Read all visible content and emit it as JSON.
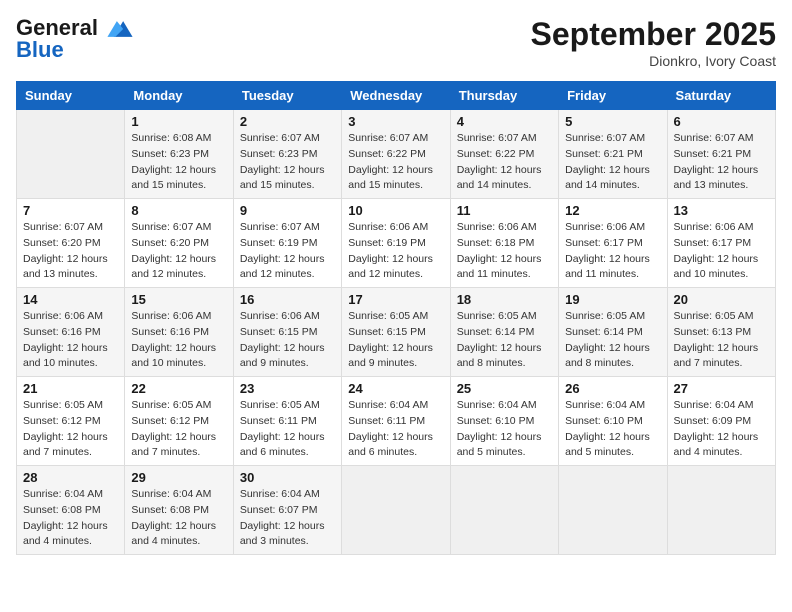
{
  "header": {
    "logo_line1": "General",
    "logo_line2": "Blue",
    "month": "September 2025",
    "location": "Dionkro, Ivory Coast"
  },
  "days_of_week": [
    "Sunday",
    "Monday",
    "Tuesday",
    "Wednesday",
    "Thursday",
    "Friday",
    "Saturday"
  ],
  "weeks": [
    [
      {
        "day": "",
        "info": ""
      },
      {
        "day": "1",
        "info": "Sunrise: 6:08 AM\nSunset: 6:23 PM\nDaylight: 12 hours\nand 15 minutes."
      },
      {
        "day": "2",
        "info": "Sunrise: 6:07 AM\nSunset: 6:23 PM\nDaylight: 12 hours\nand 15 minutes."
      },
      {
        "day": "3",
        "info": "Sunrise: 6:07 AM\nSunset: 6:22 PM\nDaylight: 12 hours\nand 15 minutes."
      },
      {
        "day": "4",
        "info": "Sunrise: 6:07 AM\nSunset: 6:22 PM\nDaylight: 12 hours\nand 14 minutes."
      },
      {
        "day": "5",
        "info": "Sunrise: 6:07 AM\nSunset: 6:21 PM\nDaylight: 12 hours\nand 14 minutes."
      },
      {
        "day": "6",
        "info": "Sunrise: 6:07 AM\nSunset: 6:21 PM\nDaylight: 12 hours\nand 13 minutes."
      }
    ],
    [
      {
        "day": "7",
        "info": "Sunrise: 6:07 AM\nSunset: 6:20 PM\nDaylight: 12 hours\nand 13 minutes."
      },
      {
        "day": "8",
        "info": "Sunrise: 6:07 AM\nSunset: 6:20 PM\nDaylight: 12 hours\nand 12 minutes."
      },
      {
        "day": "9",
        "info": "Sunrise: 6:07 AM\nSunset: 6:19 PM\nDaylight: 12 hours\nand 12 minutes."
      },
      {
        "day": "10",
        "info": "Sunrise: 6:06 AM\nSunset: 6:19 PM\nDaylight: 12 hours\nand 12 minutes."
      },
      {
        "day": "11",
        "info": "Sunrise: 6:06 AM\nSunset: 6:18 PM\nDaylight: 12 hours\nand 11 minutes."
      },
      {
        "day": "12",
        "info": "Sunrise: 6:06 AM\nSunset: 6:17 PM\nDaylight: 12 hours\nand 11 minutes."
      },
      {
        "day": "13",
        "info": "Sunrise: 6:06 AM\nSunset: 6:17 PM\nDaylight: 12 hours\nand 10 minutes."
      }
    ],
    [
      {
        "day": "14",
        "info": "Sunrise: 6:06 AM\nSunset: 6:16 PM\nDaylight: 12 hours\nand 10 minutes."
      },
      {
        "day": "15",
        "info": "Sunrise: 6:06 AM\nSunset: 6:16 PM\nDaylight: 12 hours\nand 10 minutes."
      },
      {
        "day": "16",
        "info": "Sunrise: 6:06 AM\nSunset: 6:15 PM\nDaylight: 12 hours\nand 9 minutes."
      },
      {
        "day": "17",
        "info": "Sunrise: 6:05 AM\nSunset: 6:15 PM\nDaylight: 12 hours\nand 9 minutes."
      },
      {
        "day": "18",
        "info": "Sunrise: 6:05 AM\nSunset: 6:14 PM\nDaylight: 12 hours\nand 8 minutes."
      },
      {
        "day": "19",
        "info": "Sunrise: 6:05 AM\nSunset: 6:14 PM\nDaylight: 12 hours\nand 8 minutes."
      },
      {
        "day": "20",
        "info": "Sunrise: 6:05 AM\nSunset: 6:13 PM\nDaylight: 12 hours\nand 7 minutes."
      }
    ],
    [
      {
        "day": "21",
        "info": "Sunrise: 6:05 AM\nSunset: 6:12 PM\nDaylight: 12 hours\nand 7 minutes."
      },
      {
        "day": "22",
        "info": "Sunrise: 6:05 AM\nSunset: 6:12 PM\nDaylight: 12 hours\nand 7 minutes."
      },
      {
        "day": "23",
        "info": "Sunrise: 6:05 AM\nSunset: 6:11 PM\nDaylight: 12 hours\nand 6 minutes."
      },
      {
        "day": "24",
        "info": "Sunrise: 6:04 AM\nSunset: 6:11 PM\nDaylight: 12 hours\nand 6 minutes."
      },
      {
        "day": "25",
        "info": "Sunrise: 6:04 AM\nSunset: 6:10 PM\nDaylight: 12 hours\nand 5 minutes."
      },
      {
        "day": "26",
        "info": "Sunrise: 6:04 AM\nSunset: 6:10 PM\nDaylight: 12 hours\nand 5 minutes."
      },
      {
        "day": "27",
        "info": "Sunrise: 6:04 AM\nSunset: 6:09 PM\nDaylight: 12 hours\nand 4 minutes."
      }
    ],
    [
      {
        "day": "28",
        "info": "Sunrise: 6:04 AM\nSunset: 6:08 PM\nDaylight: 12 hours\nand 4 minutes."
      },
      {
        "day": "29",
        "info": "Sunrise: 6:04 AM\nSunset: 6:08 PM\nDaylight: 12 hours\nand 4 minutes."
      },
      {
        "day": "30",
        "info": "Sunrise: 6:04 AM\nSunset: 6:07 PM\nDaylight: 12 hours\nand 3 minutes."
      },
      {
        "day": "",
        "info": ""
      },
      {
        "day": "",
        "info": ""
      },
      {
        "day": "",
        "info": ""
      },
      {
        "day": "",
        "info": ""
      }
    ]
  ]
}
